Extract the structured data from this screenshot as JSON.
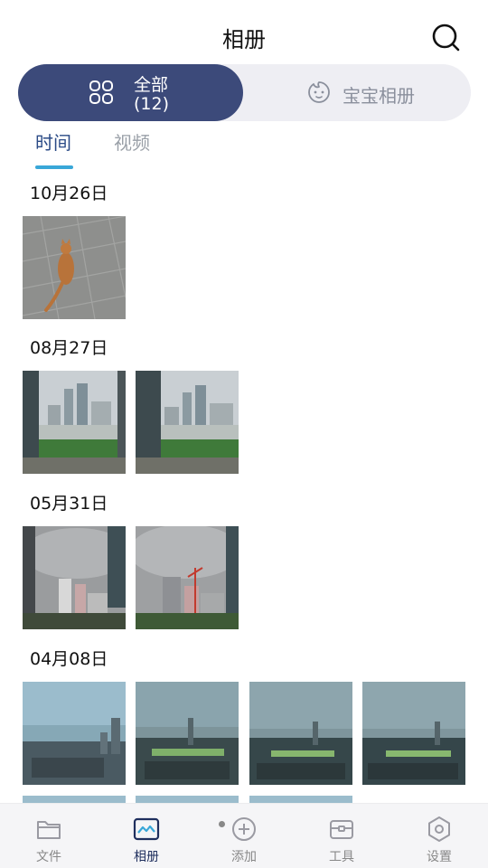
{
  "header": {
    "title": "相册"
  },
  "segments": {
    "all": {
      "label_line1": "全部",
      "label_line2": "(12)"
    },
    "baby": {
      "label": "宝宝相册"
    }
  },
  "tabs": [
    {
      "label": "时间"
    },
    {
      "label": "视频"
    }
  ],
  "groups": [
    {
      "date": "10月26日",
      "photos": [
        "cat-on-pavement"
      ]
    },
    {
      "date": "08月27日",
      "photos": [
        "city-skyline",
        "city-skyline"
      ]
    },
    {
      "date": "05月31日",
      "photos": [
        "cloudy-buildings",
        "cloudy-crane"
      ]
    },
    {
      "date": "04月08日",
      "photos": [
        "bay-city-view",
        "city-dusk",
        "city-dusk-lights",
        "city-dusk-lights"
      ]
    }
  ],
  "bottom_nav": [
    {
      "label": "文件",
      "icon": "folder-icon"
    },
    {
      "label": "相册",
      "icon": "album-icon",
      "active": true
    },
    {
      "label": "添加",
      "icon": "add-icon"
    },
    {
      "label": "工具",
      "icon": "toolbox-icon"
    },
    {
      "label": "设置",
      "icon": "settings-icon"
    }
  ],
  "colors": {
    "accent": "#3c4a7a",
    "tab_indicator": "#39a7d8",
    "active_tab_text": "#2a4a86"
  }
}
